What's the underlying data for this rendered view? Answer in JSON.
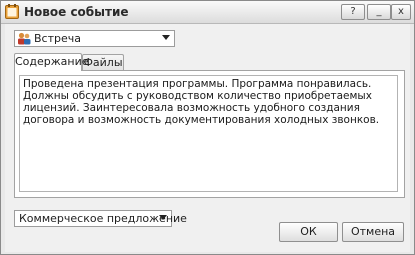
{
  "window": {
    "title": "Новое событие",
    "help_label": "?",
    "minimize_label": "_",
    "close_label": "x"
  },
  "event_type": {
    "value": "Встреча",
    "icon": "people-meeting-icon"
  },
  "tabs": [
    {
      "label": "Содержание",
      "active": true
    },
    {
      "label": "Файлы",
      "active": false
    }
  ],
  "content": {
    "text": "Проведена презентация программы. Программа понравилась. Должны обсудить с руководством количество приобретаемых лицензий. Заинтересовала возможность удобного создания договора и возможность документирования холодных звонков."
  },
  "category": {
    "value": "Коммерческое предложение"
  },
  "buttons": {
    "ok": "ОК",
    "cancel": "Отмена"
  },
  "colors": {
    "window_bg": "#e9e9e9",
    "panel_bg": "#ffffff",
    "border": "#a3a3a3"
  }
}
